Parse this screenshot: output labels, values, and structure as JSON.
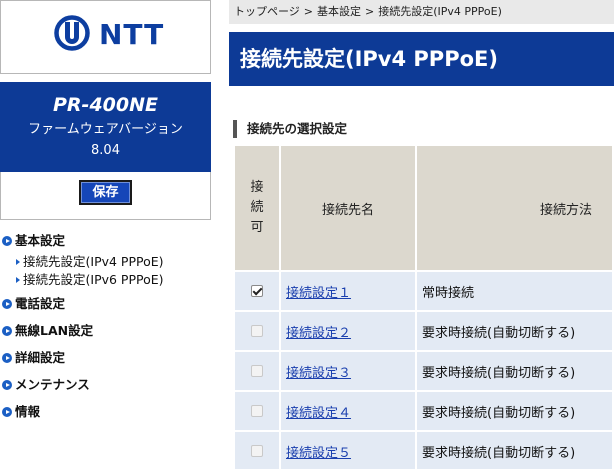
{
  "sidebar": {
    "logo_text": "NTT",
    "model_name": "PR-400NE",
    "firmware_label": "ファームウェアバージョン",
    "firmware_version": "8.04",
    "save_label": "保存",
    "nav": {
      "basic": "基本設定",
      "basic_sub": [
        "接続先設定(IPv4 PPPoE)",
        "接続先設定(IPv6 PPPoE)"
      ],
      "phone": "電話設定",
      "wlan": "無線LAN設定",
      "advanced": "詳細設定",
      "maintenance": "メンテナンス",
      "info": "情報"
    }
  },
  "breadcrumb": [
    "トップページ",
    "基本設定",
    "接続先設定(IPv4 PPPoE)"
  ],
  "breadcrumb_separator": ">",
  "page_title": "接続先設定(IPv4 PPPoE)",
  "section_title": "接続先の選択設定",
  "table": {
    "headers": {
      "enable": [
        "接",
        "続",
        "可"
      ],
      "name": "接続先名",
      "method": "接続方法"
    },
    "rows": [
      {
        "checked": true,
        "enabled": true,
        "name": "接続設定１",
        "method": "常時接続"
      },
      {
        "checked": false,
        "enabled": false,
        "name": "接続設定２",
        "method": "要求時接続(自動切断する)"
      },
      {
        "checked": false,
        "enabled": false,
        "name": "接続設定３",
        "method": "要求時接続(自動切断する)"
      },
      {
        "checked": false,
        "enabled": false,
        "name": "接続設定４",
        "method": "要求時接続(自動切断する)"
      },
      {
        "checked": false,
        "enabled": false,
        "name": "接続設定５",
        "method": "要求時接続(自動切断する)"
      }
    ]
  },
  "colors": {
    "brand_blue": "#0d3a96",
    "header_bg": "#dcd8ce",
    "row_bg": "#e3eaf4",
    "link": "#1a3fae"
  },
  "icons": {
    "logo": "ntt-logo-icon",
    "nav_bullet": "circle-arrow-icon",
    "sub_bullet": "triangle-right-icon"
  }
}
